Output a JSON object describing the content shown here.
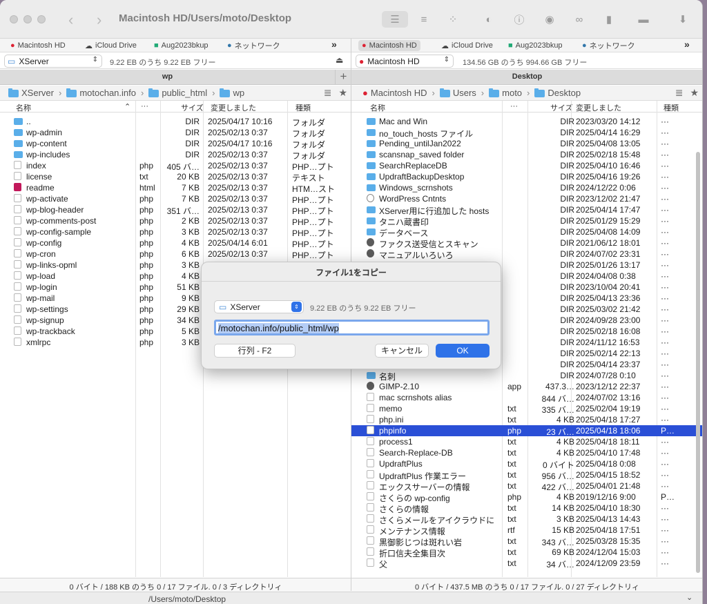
{
  "title": "Macintosh HD/Users/moto/Desktop",
  "favorites": [
    "Macintosh HD",
    "iCloud Drive",
    "Aug2023bkup",
    "ネットワーク"
  ],
  "more": "»",
  "left": {
    "drive": "XServer",
    "drive_info": "9.22 EB のうち 9.22 EB フリー",
    "tab": "wp",
    "crumbs": [
      "XServer",
      "motochan.info",
      "public_html",
      "wp"
    ],
    "headers": [
      "名称",
      "···",
      "サイズ",
      "変更しました",
      "種類"
    ],
    "rows": [
      {
        "i": "f",
        "n": "..",
        "e": "",
        "s": "DIR",
        "d": "2025/04/17 10:16",
        "t": "フォルダ"
      },
      {
        "i": "f",
        "n": "wp-admin",
        "e": "",
        "s": "DIR",
        "d": "2025/02/13 0:37",
        "t": "フォルダ"
      },
      {
        "i": "f",
        "n": "wp-content",
        "e": "",
        "s": "DIR",
        "d": "2025/04/17 10:16",
        "t": "フォルダ"
      },
      {
        "i": "f",
        "n": "wp-includes",
        "e": "",
        "s": "DIR",
        "d": "2025/02/13 0:37",
        "t": "フォルダ"
      },
      {
        "i": "d",
        "n": "index",
        "e": "php",
        "s": "405 バ…",
        "d": "2025/02/13 0:37",
        "t": "PHP…プト"
      },
      {
        "i": "d",
        "n": "license",
        "e": "txt",
        "s": "20 KB",
        "d": "2025/02/13 0:37",
        "t": "テキスト"
      },
      {
        "i": "r",
        "n": "readme",
        "e": "html",
        "s": "7 KB",
        "d": "2025/02/13 0:37",
        "t": "HTM…スト"
      },
      {
        "i": "d",
        "n": "wp-activate",
        "e": "php",
        "s": "7 KB",
        "d": "2025/02/13 0:37",
        "t": "PHP…プト"
      },
      {
        "i": "d",
        "n": "wp-blog-header",
        "e": "php",
        "s": "351 バ…",
        "d": "2025/02/13 0:37",
        "t": "PHP…プト"
      },
      {
        "i": "d",
        "n": "wp-comments-post",
        "e": "php",
        "s": "2 KB",
        "d": "2025/02/13 0:37",
        "t": "PHP…プト"
      },
      {
        "i": "d",
        "n": "wp-config-sample",
        "e": "php",
        "s": "3 KB",
        "d": "2025/02/13 0:37",
        "t": "PHP…プト"
      },
      {
        "i": "d",
        "n": "wp-config",
        "e": "php",
        "s": "4 KB",
        "d": "2025/04/14 6:01",
        "t": "PHP…プト"
      },
      {
        "i": "d",
        "n": "wp-cron",
        "e": "php",
        "s": "6 KB",
        "d": "2025/02/13 0:37",
        "t": "PHP…プト"
      },
      {
        "i": "d",
        "n": "wp-links-opml",
        "e": "php",
        "s": "3 KB",
        "d": "",
        "t": ""
      },
      {
        "i": "d",
        "n": "wp-load",
        "e": "php",
        "s": "4 KB",
        "d": "",
        "t": ""
      },
      {
        "i": "d",
        "n": "wp-login",
        "e": "php",
        "s": "51 KB",
        "d": "",
        "t": ""
      },
      {
        "i": "d",
        "n": "wp-mail",
        "e": "php",
        "s": "9 KB",
        "d": "",
        "t": ""
      },
      {
        "i": "d",
        "n": "wp-settings",
        "e": "php",
        "s": "29 KB",
        "d": "",
        "t": ""
      },
      {
        "i": "d",
        "n": "wp-signup",
        "e": "php",
        "s": "34 KB",
        "d": "",
        "t": ""
      },
      {
        "i": "d",
        "n": "wp-trackback",
        "e": "php",
        "s": "5 KB",
        "d": "",
        "t": ""
      },
      {
        "i": "d",
        "n": "xmlrpc",
        "e": "php",
        "s": "3 KB",
        "d": "",
        "t": ""
      }
    ],
    "status": "0 バイト / 188 KB のうち 0 / 17 ファイル. 0 / 3 ディレクトリィ"
  },
  "right": {
    "drive": "Macintosh HD",
    "drive_info": "134.56 GB のうち 994.66 GB フリー",
    "tab": "Desktop",
    "crumbs": [
      "Macintosh HD",
      "Users",
      "moto",
      "Desktop"
    ],
    "headers": [
      "名称",
      "···",
      "サイズ",
      "変更しました",
      "種類"
    ],
    "rows": [
      {
        "i": "f",
        "n": "Mac and Win",
        "e": "",
        "s": "DIR",
        "d": "2023/03/20 14:12",
        "t": "···"
      },
      {
        "i": "f",
        "n": "no_touch_hosts ファイル",
        "e": "",
        "s": "DIR",
        "d": "2025/04/14 16:29",
        "t": "···"
      },
      {
        "i": "f",
        "n": "Pending_untilJan2022",
        "e": "",
        "s": "DIR",
        "d": "2025/04/08 13:05",
        "t": "···"
      },
      {
        "i": "f",
        "n": "scansnap_saved folder",
        "e": "",
        "s": "DIR",
        "d": "2025/02/18 15:48",
        "t": "···"
      },
      {
        "i": "f",
        "n": "SearchReplaceDB",
        "e": "",
        "s": "DIR",
        "d": "2025/04/10 16:46",
        "t": "···"
      },
      {
        "i": "f",
        "n": "UpdraftBackupDesktop",
        "e": "",
        "s": "DIR",
        "d": "2025/04/16 19:26",
        "t": "···"
      },
      {
        "i": "f",
        "n": "Windows_scrnshots",
        "e": "",
        "s": "DIR",
        "d": "2024/12/22 0:06",
        "t": "···"
      },
      {
        "i": "w",
        "n": "WordPress Cntnts",
        "e": "",
        "s": "DIR",
        "d": "2023/12/02 21:47",
        "t": "···"
      },
      {
        "i": "f",
        "n": "XServer用に行追加した hosts",
        "e": "",
        "s": "DIR",
        "d": "2025/04/14 17:47",
        "t": "···"
      },
      {
        "i": "f",
        "n": "タニハ蔵書印",
        "e": "",
        "s": "DIR",
        "d": "2025/01/29 15:29",
        "t": "···"
      },
      {
        "i": "f",
        "n": "データベース",
        "e": "",
        "s": "DIR",
        "d": "2025/04/08 14:09",
        "t": "···"
      },
      {
        "i": "g",
        "n": "ファクス送受信とスキャン",
        "e": "",
        "s": "DIR",
        "d": "2021/06/12 18:01",
        "t": "···"
      },
      {
        "i": "g",
        "n": "マニュアルいろいろ",
        "e": "",
        "s": "DIR",
        "d": "2024/07/02 23:31",
        "t": "···"
      },
      {
        "i": "f",
        "n": "",
        "e": "",
        "s": "DIR",
        "d": "2025/01/26 13:17",
        "t": "···"
      },
      {
        "i": "f",
        "n": "",
        "e": "",
        "s": "DIR",
        "d": "2024/04/08 0:38",
        "t": "···"
      },
      {
        "i": "f",
        "n": "",
        "e": "",
        "s": "DIR",
        "d": "2023/10/04 20:41",
        "t": "···"
      },
      {
        "i": "f",
        "n": "",
        "e": "",
        "s": "DIR",
        "d": "2025/04/13 23:36",
        "t": "···"
      },
      {
        "i": "f",
        "n": "",
        "e": "",
        "s": "DIR",
        "d": "2025/03/02 21:42",
        "t": "···"
      },
      {
        "i": "f",
        "n": "",
        "e": "",
        "s": "DIR",
        "d": "2024/09/28 23:00",
        "t": "···"
      },
      {
        "i": "f",
        "n": "",
        "e": "",
        "s": "DIR",
        "d": "2025/02/18 16:08",
        "t": "···"
      },
      {
        "i": "f",
        "n": "",
        "e": "",
        "s": "DIR",
        "d": "2024/11/12 16:53",
        "t": "···"
      },
      {
        "i": "f",
        "n": "",
        "e": "",
        "s": "DIR",
        "d": "2025/02/14 22:13",
        "t": "···"
      },
      {
        "i": "f",
        "n": "",
        "e": "",
        "s": "DIR",
        "d": "2025/04/14 23:37",
        "t": "···"
      },
      {
        "i": "f",
        "n": "名刺",
        "e": "",
        "s": "DIR",
        "d": "2024/07/28 0:10",
        "t": "···"
      },
      {
        "i": "g",
        "n": "GIMP-2.10",
        "e": "app",
        "s": "437.3…",
        "d": "2023/12/12 22:37",
        "t": "···"
      },
      {
        "i": "d",
        "n": "mac scrnshots alias",
        "e": "",
        "s": "844 バ…",
        "d": "2024/07/02 13:16",
        "t": "···"
      },
      {
        "i": "d",
        "n": "memo",
        "e": "txt",
        "s": "335 バ…",
        "d": "2025/02/04 19:19",
        "t": "···"
      },
      {
        "i": "d",
        "n": "php.ini",
        "e": "txt",
        "s": "4 KB",
        "d": "2025/04/18 17:27",
        "t": "···"
      },
      {
        "i": "d",
        "n": "phpinfo",
        "e": "php",
        "s": "23 バ…",
        "d": "2025/04/18 18:06",
        "t": "P…",
        "sel": true
      },
      {
        "i": "d",
        "n": "process1",
        "e": "txt",
        "s": "4 KB",
        "d": "2025/04/18 18:11",
        "t": "···"
      },
      {
        "i": "d",
        "n": "Search-Replace-DB",
        "e": "txt",
        "s": "4 KB",
        "d": "2025/04/10 17:48",
        "t": "···"
      },
      {
        "i": "d",
        "n": "UpdraftPlus",
        "e": "txt",
        "s": "0 バイト",
        "d": "2025/04/18 0:08",
        "t": "···"
      },
      {
        "i": "d",
        "n": "UpdraftPlus 作業エラー",
        "e": "txt",
        "s": "956 バ…",
        "d": "2025/04/15 18:52",
        "t": "···"
      },
      {
        "i": "d",
        "n": "エックスサーバーの情報",
        "e": "txt",
        "s": "422 バ…",
        "d": "2025/04/01 21:48",
        "t": "···"
      },
      {
        "i": "d",
        "n": "さくらの wp-config",
        "e": "php",
        "s": "4 KB",
        "d": "2019/12/16 9:00",
        "t": "P…"
      },
      {
        "i": "d",
        "n": "さくらの情報",
        "e": "txt",
        "s": "14 KB",
        "d": "2025/04/10 18:30",
        "t": "···"
      },
      {
        "i": "d",
        "n": "さくらメールをアイクラウドに",
        "e": "txt",
        "s": "3 KB",
        "d": "2025/04/13 14:43",
        "t": "···"
      },
      {
        "i": "d",
        "n": "メンテナンス情報",
        "e": "rtf",
        "s": "15 KB",
        "d": "2025/04/18 17:51",
        "t": "···"
      },
      {
        "i": "d",
        "n": "黒御影じつは斑れい岩",
        "e": "txt",
        "s": "343 バ…",
        "d": "2025/03/28 15:35",
        "t": "···"
      },
      {
        "i": "d",
        "n": "折口信夫全集目次",
        "e": "txt",
        "s": "69 KB",
        "d": "2024/12/04 15:03",
        "t": "···"
      },
      {
        "i": "d",
        "n": "父",
        "e": "txt",
        "s": "34 バ…",
        "d": "2024/12/09 23:59",
        "t": "···"
      }
    ],
    "status": "0 バイト / 437.5 MB のうち 0 / 17 ファイル. 0 / 27 ディレクトリィ"
  },
  "path": "/Users/moto/Desktop",
  "dialog": {
    "title": "ファイル1をコピー",
    "drive": "XServer",
    "drive_info": "9.22 EB のうち 9.22 EB フリー",
    "path": "/motochan.info/public_html/wp",
    "queue": "行列 - F2",
    "cancel": "キャンセル",
    "ok": "OK"
  }
}
